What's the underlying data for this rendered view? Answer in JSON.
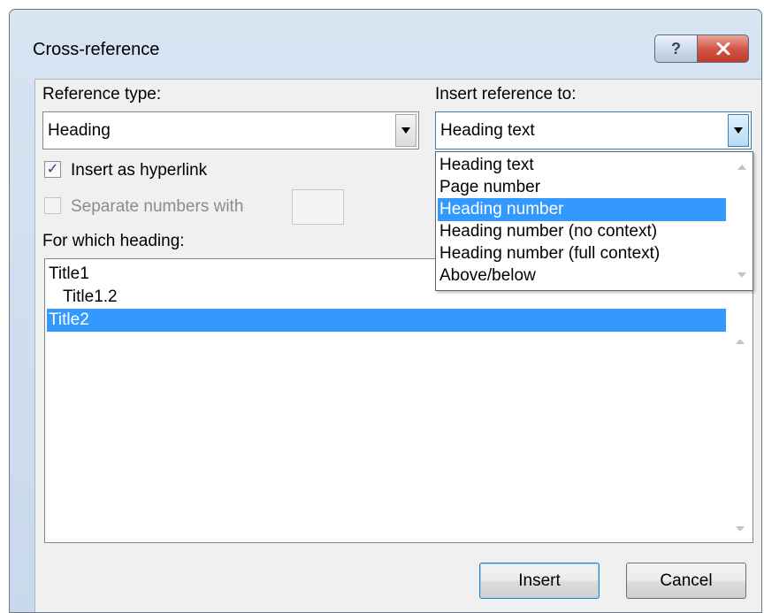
{
  "window": {
    "title": "Cross-reference",
    "help_label": "?",
    "close_label": "✕"
  },
  "reference_type": {
    "label": "Reference type:",
    "value": "Heading"
  },
  "insert_reference": {
    "label": "Insert reference to:",
    "value": "Heading text",
    "options": [
      "Heading text",
      "Page number",
      "Heading number",
      "Heading number (no context)",
      "Heading number (full  context)",
      "Above/below"
    ],
    "highlighted_index": 2
  },
  "options": {
    "insert_hyperlink": {
      "label": "Insert as hyperlink",
      "checked": true
    },
    "separate_numbers": {
      "label": "Separate numbers with",
      "checked": false,
      "enabled": false,
      "value": ""
    }
  },
  "headings": {
    "label": "For which heading:",
    "items": [
      "Title1",
      "Title1.2",
      "Title2"
    ],
    "selected_index": 2
  },
  "buttons": {
    "insert": "Insert",
    "cancel": "Cancel"
  },
  "colors": {
    "selection": "#3399ff",
    "dialog_bg": "#f0f0f0",
    "frame": "#c8d9eb",
    "close_button": "#c23a2c"
  }
}
